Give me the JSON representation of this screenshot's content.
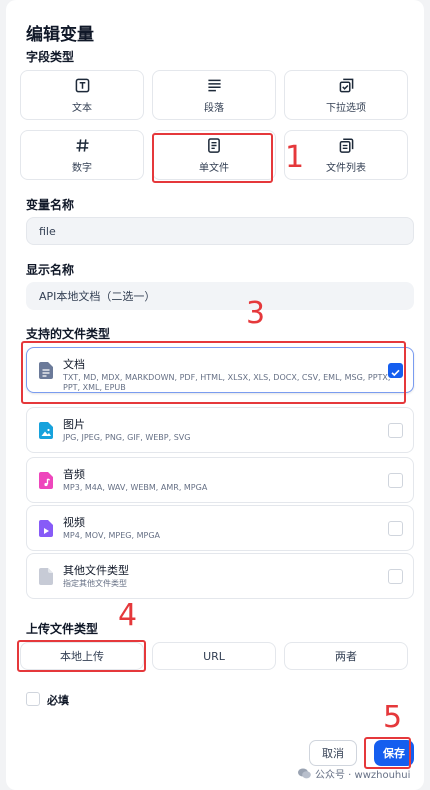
{
  "dialog": {
    "title": "编辑变量",
    "field_type_label": "字段类型",
    "field_types": [
      {
        "label": "文本",
        "icon": "text-icon"
      },
      {
        "label": "段落",
        "icon": "paragraph-icon"
      },
      {
        "label": "下拉选项",
        "icon": "dropdown-icon"
      },
      {
        "label": "数字",
        "icon": "number-icon"
      },
      {
        "label": "单文件",
        "icon": "single-file-icon"
      },
      {
        "label": "文件列表",
        "icon": "file-list-icon"
      }
    ],
    "variable_name_label": "变量名称",
    "variable_name_value": "file",
    "display_name_label": "显示名称",
    "display_name_value": "API本地文档（二选一）",
    "supported_types_label": "支持的文件类型",
    "file_types": [
      {
        "name": "文档",
        "desc": "TXT, MD, MDX, MARKDOWN, PDF, HTML, XLSX, XLS, DOCX, CSV, EML, MSG, PPTX, PPT, XML, EPUB",
        "checked": true,
        "color": "#6b7a99"
      },
      {
        "name": "图片",
        "desc": "JPG, JPEG, PNG, GIF, WEBP, SVG",
        "checked": false,
        "color": "#17a2dc"
      },
      {
        "name": "音频",
        "desc": "MP3, M4A, WAV, WEBM, AMR, MPGA",
        "checked": false,
        "color": "#ee46bc"
      },
      {
        "name": "视频",
        "desc": "MP4, MOV, MPEG, MPGA",
        "checked": false,
        "color": "#875bf7"
      },
      {
        "name": "其他文件类型",
        "desc": "指定其他文件类型",
        "checked": false,
        "color": "#c7cbd6"
      }
    ],
    "upload_type_label": "上传文件类型",
    "upload_options": [
      "本地上传",
      "URL",
      "两者"
    ],
    "required_label": "必填",
    "cancel_label": "取消",
    "save_label": "保存"
  },
  "annotations": [
    "1",
    "3",
    "4",
    "5"
  ],
  "watermark": "公众号 · wwzhouhui",
  "colors": {
    "accent": "#155eef",
    "annotation": "#e5383b"
  }
}
